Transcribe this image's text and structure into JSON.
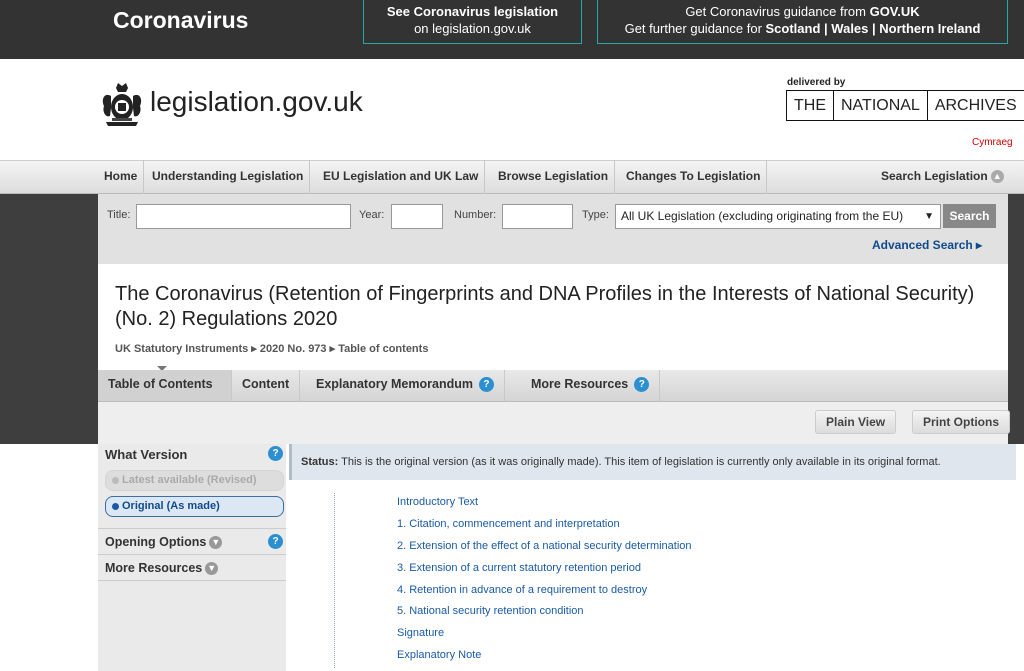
{
  "banner": {
    "title": "Coronavirus",
    "box1_line1": "See Coronavirus legislation",
    "box1_line2": "on legislation.gov.uk",
    "box2_line1_prefix": "Get Coronavirus guidance from ",
    "box2_line1_bold": "GOV.UK",
    "box2_line2_prefix": "Get further guidance for ",
    "box2_scotland": "Scotland",
    "box2_sep1": " | ",
    "box2_wales": "Wales",
    "box2_sep2": " | ",
    "box2_ni": "Northern Ireland",
    "accent_color": "#27a7a4"
  },
  "header": {
    "logo_text": "legislation.gov.uk",
    "delivered_by": "delivered by",
    "tna": [
      "THE",
      "NATIONAL",
      "ARCHIVES"
    ],
    "cymraeg": "Cymraeg"
  },
  "nav": {
    "items": [
      "Home",
      "Understanding Legislation",
      "EU Legislation and UK Law",
      "Browse Legislation",
      "Changes To Legislation"
    ],
    "search": "Search Legislation"
  },
  "search": {
    "title_label": "Title:",
    "year_label": "Year:",
    "number_label": "Number:",
    "type_label": "Type:",
    "type_value": "All UK Legislation (excluding originating from the EU)",
    "button": "Search",
    "advanced": "Advanced Search ▸"
  },
  "document": {
    "title": "The Coronavirus (Retention of Fingerprints and DNA Profiles in the Interests of National Security) (No. 2) Regulations 2020",
    "breadcrumb": [
      "UK Statutory Instruments",
      "2020 No. 973",
      "Table of contents"
    ]
  },
  "tabs": [
    "Table of Contents",
    "Content",
    "Explanatory Memorandum",
    "More Resources"
  ],
  "toolbar": {
    "plain_view": "Plain View",
    "print_options": "Print Options"
  },
  "sidebar": {
    "what_version": "What Version",
    "latest": "Latest available (Revised)",
    "original": "Original (As made)",
    "opening_options": "Opening Options",
    "more_resources": "More Resources"
  },
  "status": {
    "label": "Status:",
    "text": " This is the original version (as it was originally made). This item of legislation is currently only available in its original format."
  },
  "toc": [
    "Introductory Text",
    "1. Citation, commencement and interpretation",
    "2. Extension of the effect of a national security determination",
    "3. Extension of a current statutory retention period",
    "4. Retention in advance of a requirement to destroy",
    "5. National security retention condition",
    "Signature",
    "Explanatory Note"
  ]
}
